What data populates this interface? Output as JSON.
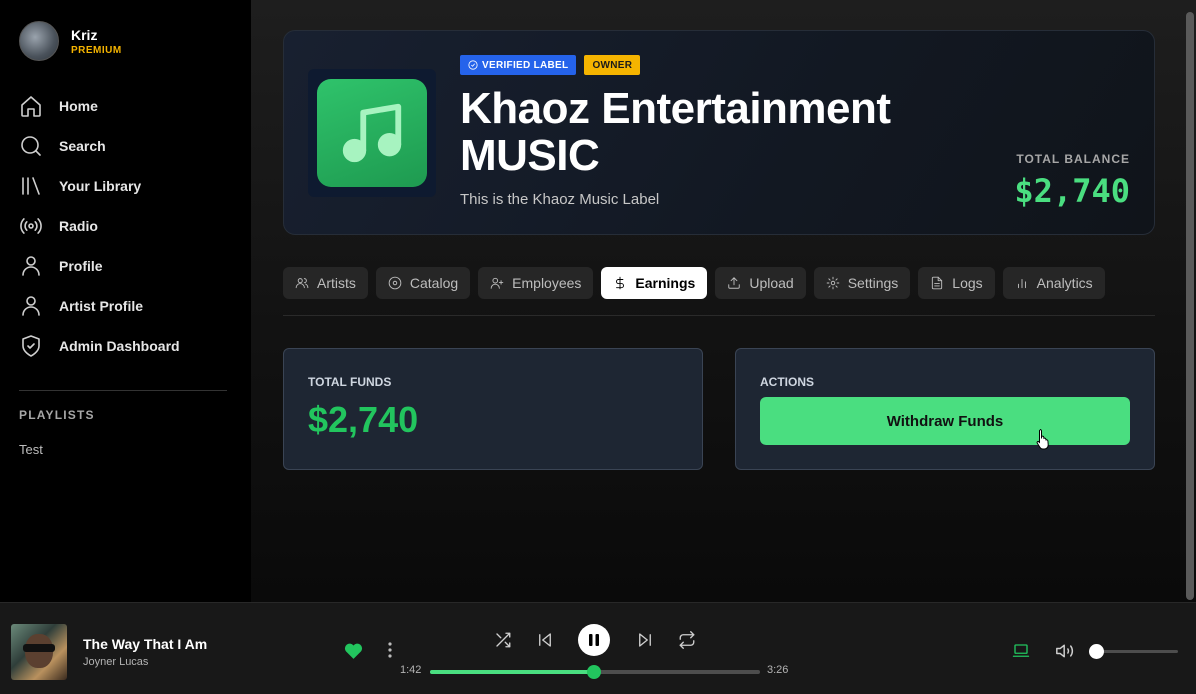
{
  "user": {
    "name": "Kriz",
    "tier": "PREMIUM"
  },
  "nav": [
    {
      "label": "Home",
      "icon": "home-icon"
    },
    {
      "label": "Search",
      "icon": "search-icon"
    },
    {
      "label": "Your Library",
      "icon": "library-icon"
    },
    {
      "label": "Radio",
      "icon": "radio-icon"
    },
    {
      "label": "Profile",
      "icon": "user-icon"
    },
    {
      "label": "Artist Profile",
      "icon": "user-icon"
    },
    {
      "label": "Admin Dashboard",
      "icon": "shield-icon"
    }
  ],
  "playlists": {
    "title": "PLAYLISTS",
    "items": [
      "Test"
    ]
  },
  "label": {
    "badge_verified": "VERIFIED LABEL",
    "badge_owner": "OWNER",
    "title": "Khaoz Entertainment MUSIC",
    "description": "This is the Khaoz Music Label",
    "balance_label": "TOTAL BALANCE",
    "balance_value": "$2,740"
  },
  "tabs": [
    {
      "label": "Artists",
      "icon": "users-icon"
    },
    {
      "label": "Catalog",
      "icon": "disc-icon"
    },
    {
      "label": "Employees",
      "icon": "user-plus-icon"
    },
    {
      "label": "Earnings",
      "icon": "dollar-icon",
      "active": true
    },
    {
      "label": "Upload",
      "icon": "upload-icon"
    },
    {
      "label": "Settings",
      "icon": "gear-icon"
    },
    {
      "label": "Logs",
      "icon": "file-icon"
    },
    {
      "label": "Analytics",
      "icon": "bar-chart-icon"
    }
  ],
  "earnings": {
    "funds_label": "TOTAL FUNDS",
    "funds_value": "$2,740",
    "actions_label": "ACTIONS",
    "withdraw_label": "Withdraw Funds"
  },
  "player": {
    "title": "The Way That I Am",
    "artist": "Joyner Lucas",
    "current_time": "1:42",
    "total_time": "3:26",
    "progress_fraction": 0.497,
    "volume_fraction": 0.07,
    "liked": true
  },
  "colors": {
    "accent": "#4ade80",
    "verified": "#2563eb",
    "owner": "#f5b400",
    "premium": "#f5b400"
  }
}
